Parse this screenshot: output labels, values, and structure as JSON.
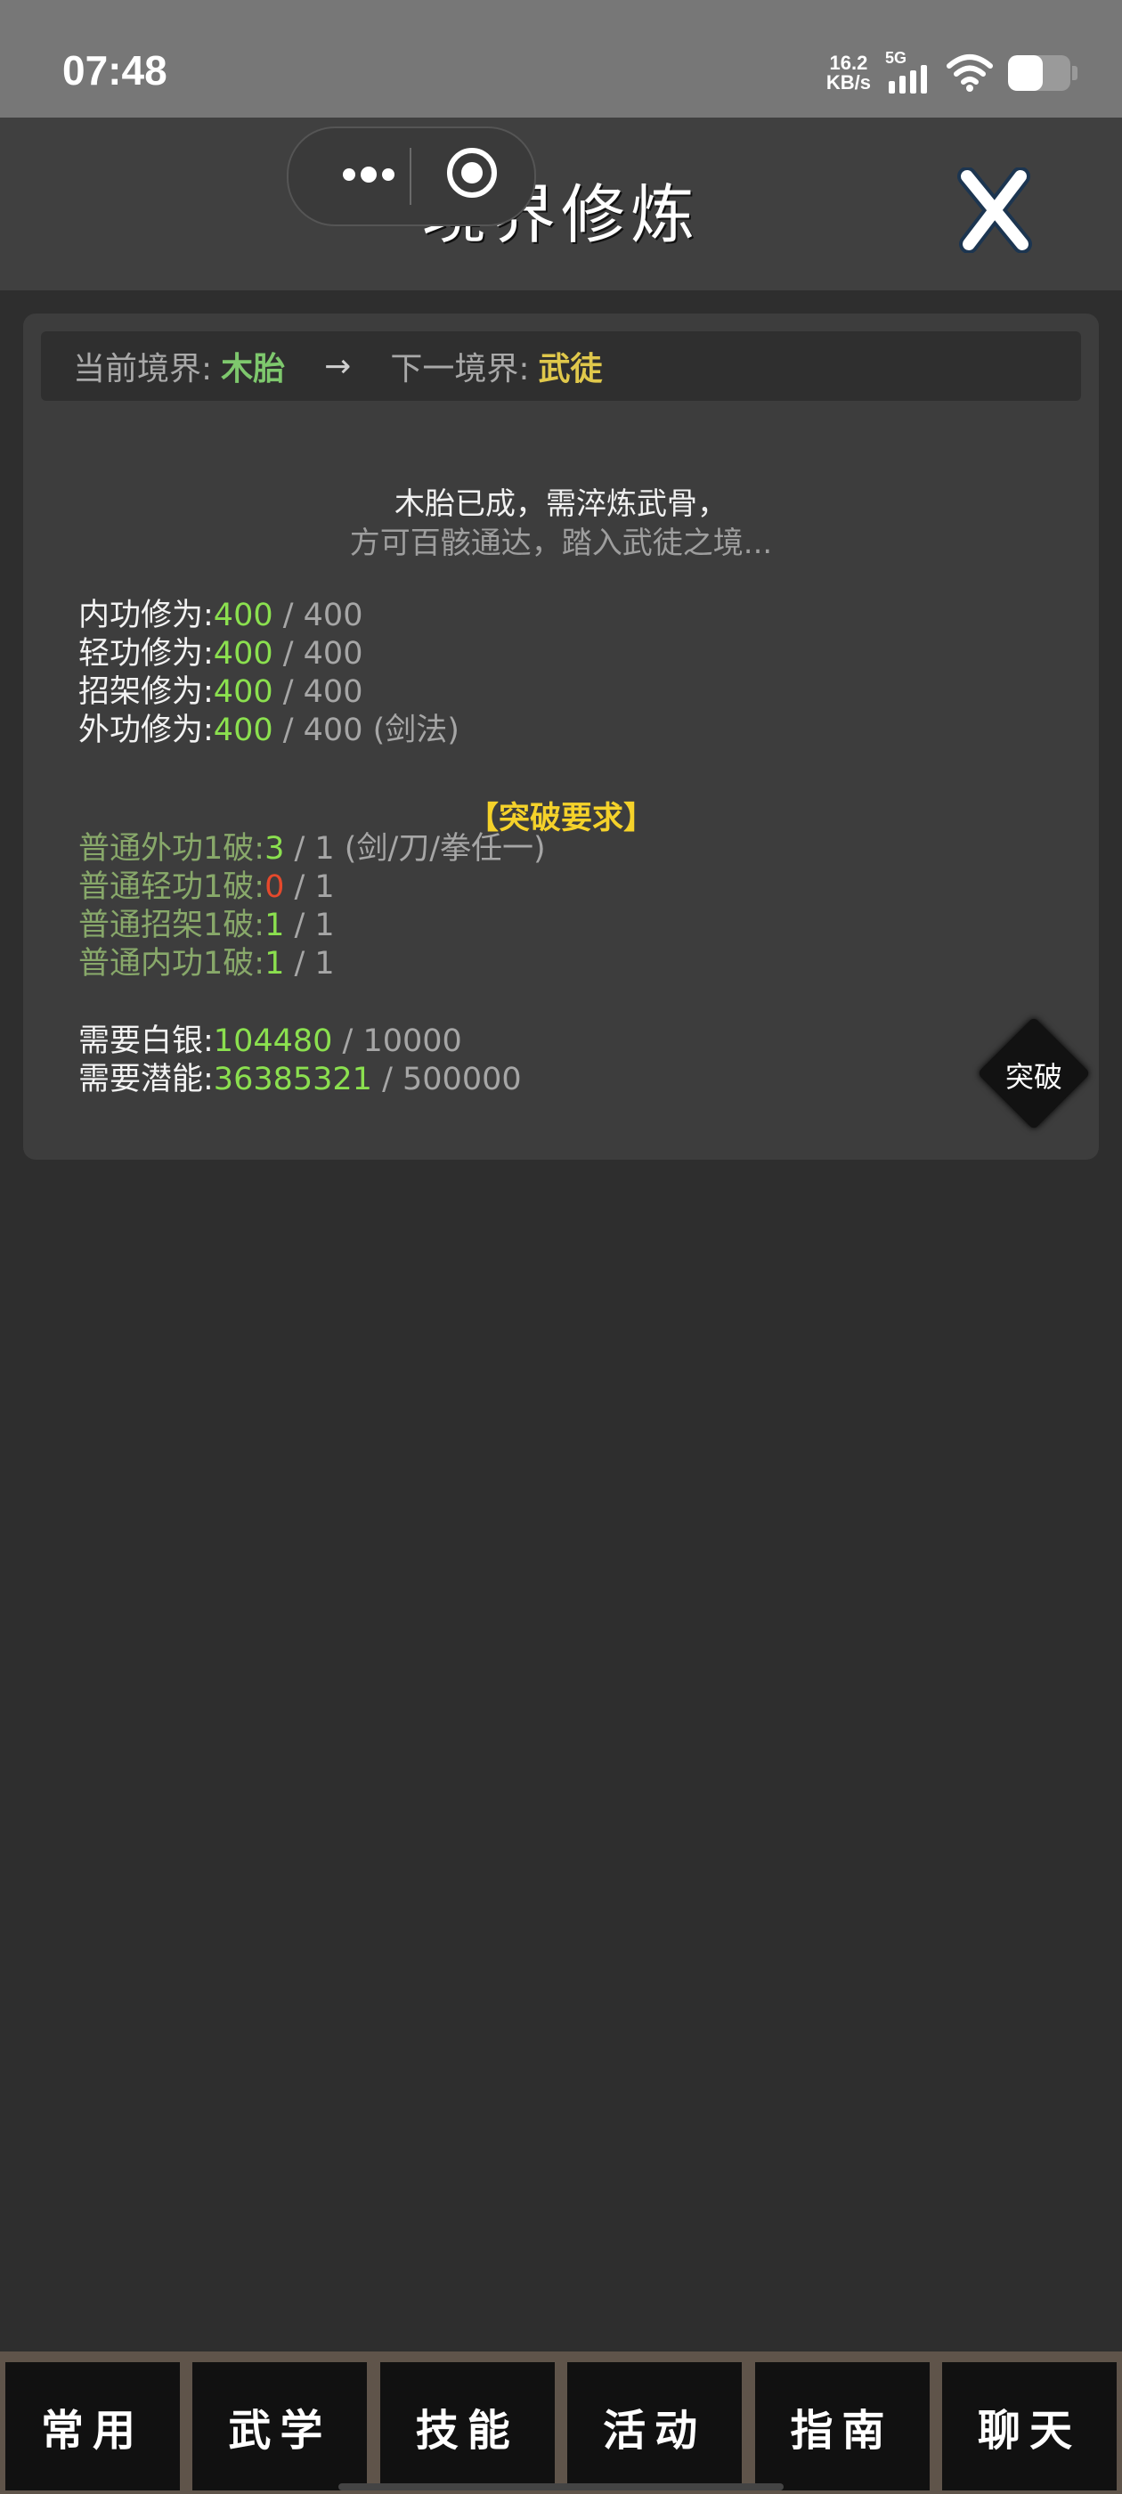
{
  "status_bar": {
    "time": "07:48",
    "net_speed_value": "16.2",
    "net_speed_unit": "KB/s",
    "network": "5G",
    "battery_level": 0.55
  },
  "header": {
    "title": "境界修炼",
    "close_icon": "close-x-icon"
  },
  "realm": {
    "current_label": "当前境界:",
    "current_value": "木胎",
    "arrow": "→",
    "next_label": "下一境界:",
    "next_value": "武徒"
  },
  "description": {
    "line1": "木胎已成，需淬炼武骨，",
    "line2": "方可百骸通达，踏入武徒之境..."
  },
  "cultivation": [
    {
      "label": "内功修为:",
      "value": "400",
      "max": "/ 400",
      "note": ""
    },
    {
      "label": "轻功修为:",
      "value": "400",
      "max": "/ 400",
      "note": ""
    },
    {
      "label": "招架修为:",
      "value": "400",
      "max": "/ 400",
      "note": ""
    },
    {
      "label": "外功修为:",
      "value": "400",
      "max": "/ 400",
      "note": " (剑法)"
    }
  ],
  "requirements": {
    "title": "【突破要求】",
    "items": [
      {
        "label": "普通外功1破:",
        "value": "3",
        "max": "/ 1",
        "note": " (剑/刀/拳任一)",
        "status": "met"
      },
      {
        "label": "普通轻功1破:",
        "value": "0",
        "max": "/ 1",
        "note": "",
        "status": "unmet"
      },
      {
        "label": "普通招架1破:",
        "value": "1",
        "max": "/ 1",
        "note": "",
        "status": "met"
      },
      {
        "label": "普通内功1破:",
        "value": "1",
        "max": "/ 1",
        "note": "",
        "status": "met"
      }
    ]
  },
  "costs": [
    {
      "label": "需要白银:",
      "value": "104480",
      "max": "/ 10000"
    },
    {
      "label": "需要潜能:",
      "value": "36385321",
      "max": "/ 500000"
    }
  ],
  "break_button": {
    "label": "突破"
  },
  "bottom_nav": [
    {
      "label": "常用"
    },
    {
      "label": "武学"
    },
    {
      "label": "技能"
    },
    {
      "label": "活动"
    },
    {
      "label": "指南"
    },
    {
      "label": "聊天"
    }
  ],
  "colors": {
    "met": "#8be04f",
    "unmet": "#e5492c",
    "current_realm": "#7ec86d",
    "next_realm": "#e0c84b",
    "requirement_title": "#f5d22a"
  }
}
